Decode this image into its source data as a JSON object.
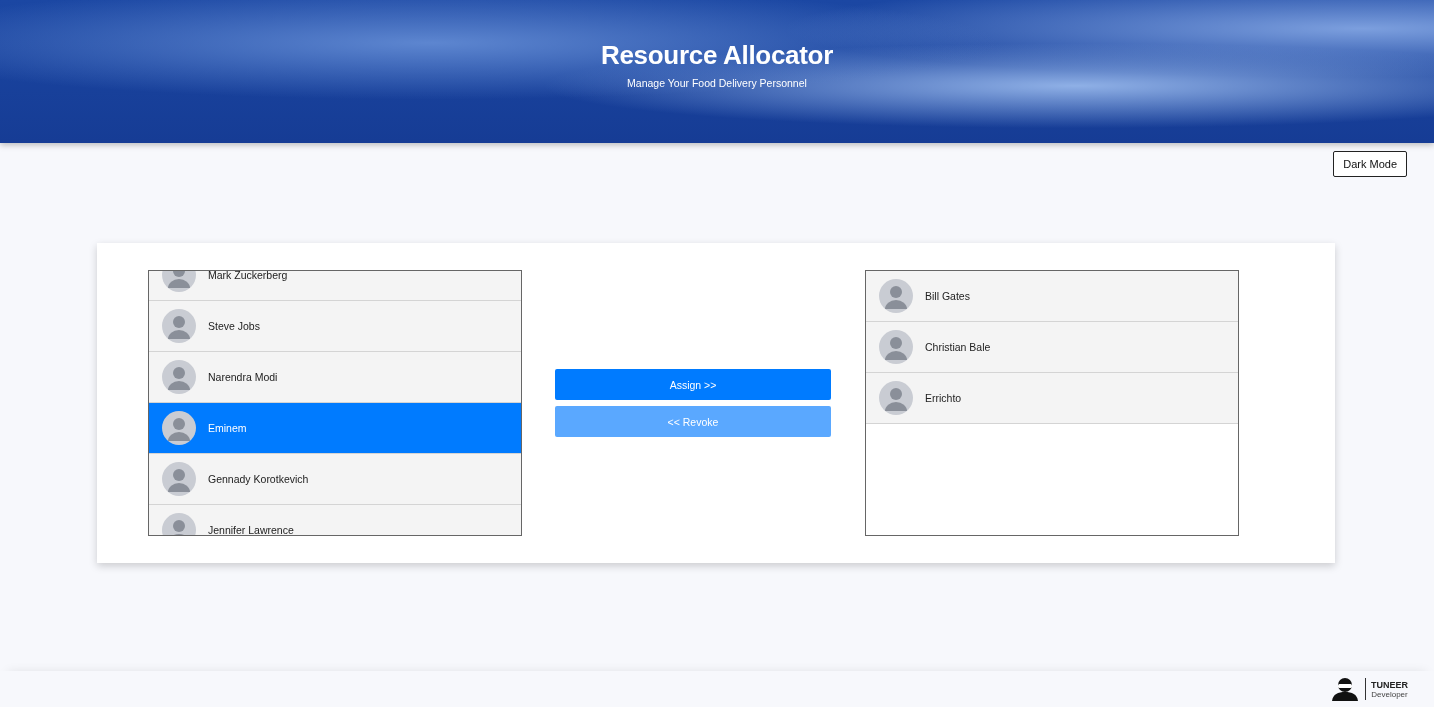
{
  "header": {
    "title": "Resource Allocator",
    "subtitle": "Manage Your Food Delivery Personnel"
  },
  "theme_button": {
    "label": "Dark Mode"
  },
  "available_list": {
    "items": [
      {
        "name": "Mark Zuckerberg",
        "selected": false
      },
      {
        "name": "Steve Jobs",
        "selected": false
      },
      {
        "name": "Narendra Modi",
        "selected": false
      },
      {
        "name": "Eminem",
        "selected": true
      },
      {
        "name": "Gennady Korotkevich",
        "selected": false
      },
      {
        "name": "Jennifer Lawrence",
        "selected": false
      }
    ]
  },
  "actions": [
    {
      "label": "Assign >>",
      "disabled": false
    },
    {
      "label": "<< Revoke",
      "disabled": true
    }
  ],
  "assigned_list": {
    "items": [
      {
        "name": "Bill Gates",
        "selected": false
      },
      {
        "name": "Christian Bale",
        "selected": false
      },
      {
        "name": "Errichto",
        "selected": false
      }
    ]
  },
  "footer": {
    "brand": "TUNEER",
    "role": "Developer"
  }
}
